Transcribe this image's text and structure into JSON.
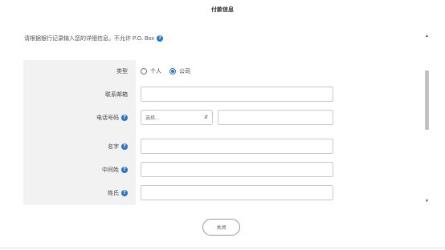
{
  "dialog": {
    "title": "付款信息",
    "notice": "请根据银行记录输入您的详细信息。不允许 P.O. Box",
    "close_label": "关闭"
  },
  "form": {
    "type": {
      "label": "类型",
      "options": [
        {
          "label": "个人",
          "selected": false
        },
        {
          "label": "公司",
          "selected": true
        }
      ]
    },
    "email": {
      "label": "联系邮箱",
      "value": ""
    },
    "phone": {
      "label": "电话号码",
      "select_placeholder": "选择...",
      "value": ""
    },
    "first_name": {
      "label": "名字",
      "value": ""
    },
    "middle_name": {
      "label": "中间姓",
      "value": ""
    },
    "last_name": {
      "label": "姓氏",
      "value": ""
    }
  },
  "icons": {
    "help": "help-icon",
    "select_arrow": "chevron-updown-icon",
    "scroll_up": "scroll-up-icon",
    "scroll_down": "scroll-down-icon"
  },
  "colors": {
    "accent": "#2b73c8",
    "panel_bg": "#f2f2f2"
  }
}
